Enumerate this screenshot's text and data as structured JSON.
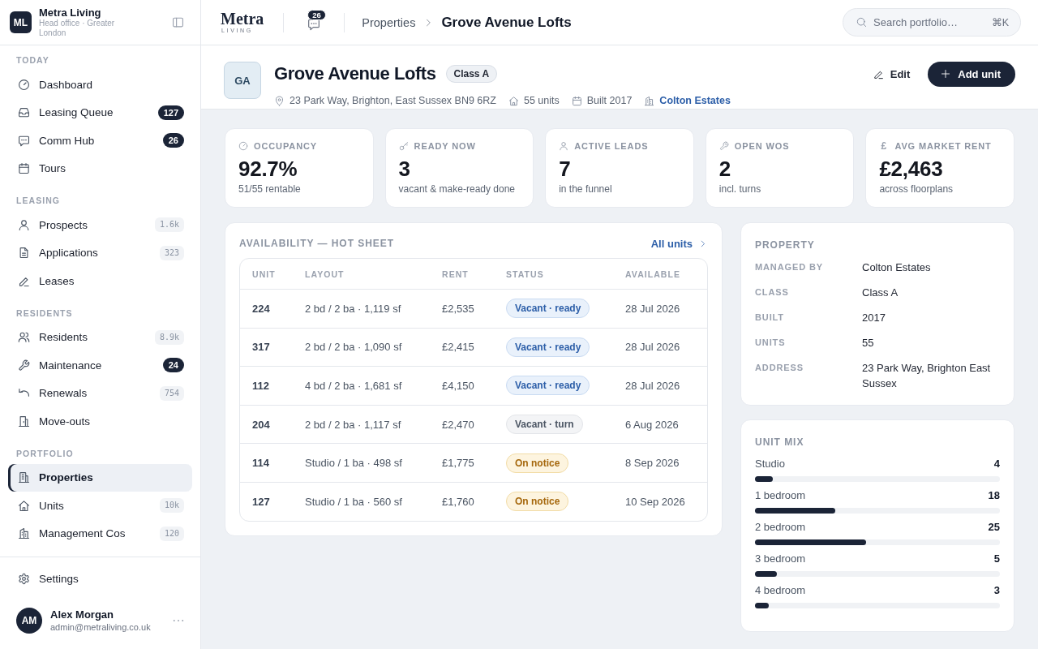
{
  "sidebar": {
    "brand": {
      "initials": "ML",
      "name": "Metra Living",
      "subtitle": "Head office · Greater London"
    },
    "sections": [
      {
        "label": "TODAY",
        "items": [
          {
            "label": "Dashboard",
            "selected": false
          },
          {
            "label": "Leasing Queue",
            "selected": false,
            "badge": {
              "text": "127",
              "kind": "solid"
            }
          },
          {
            "label": "Comm Hub",
            "selected": false,
            "badge": {
              "text": "26",
              "kind": "solid"
            }
          },
          {
            "label": "Tours",
            "selected": false
          }
        ]
      },
      {
        "label": "LEASING",
        "items": [
          {
            "label": "Prospects",
            "selected": false,
            "badge": {
              "text": "1.6k",
              "kind": "subtle"
            }
          },
          {
            "label": "Applications",
            "selected": false,
            "badge": {
              "text": "323",
              "kind": "subtle"
            }
          },
          {
            "label": "Leases",
            "selected": false
          }
        ]
      },
      {
        "label": "RESIDENTS",
        "items": [
          {
            "label": "Residents",
            "selected": false,
            "badge": {
              "text": "8.9k",
              "kind": "subtle"
            }
          },
          {
            "label": "Maintenance",
            "selected": false,
            "badge": {
              "text": "24",
              "kind": "solid"
            }
          },
          {
            "label": "Renewals",
            "selected": false,
            "badge": {
              "text": "754",
              "kind": "subtle"
            }
          },
          {
            "label": "Move-outs",
            "selected": false
          }
        ]
      },
      {
        "label": "PORTFOLIO",
        "items": [
          {
            "label": "Properties",
            "selected": true
          },
          {
            "label": "Units",
            "selected": false,
            "badge": {
              "text": "10k",
              "kind": "subtle"
            }
          },
          {
            "label": "Management Cos",
            "selected": false,
            "badge": {
              "text": "120",
              "kind": "subtle"
            }
          }
        ]
      }
    ],
    "footer_items": [
      {
        "label": "Settings",
        "selected": false
      }
    ],
    "user": {
      "initials": "AM",
      "name": "Alex Morgan",
      "email": "admin@metraliving.co.uk"
    }
  },
  "topbar": {
    "logo": {
      "word": "Metra",
      "tagline": "LIVING"
    },
    "messages_badge": "26",
    "breadcrumb": [
      {
        "label": "Properties",
        "current": false
      },
      {
        "label": "Grove Avenue Lofts",
        "current": true
      }
    ],
    "search": {
      "placeholder": "Search portfolio…",
      "shortcut": "⌘K"
    }
  },
  "property": {
    "initials": "GA",
    "name": "Grove Avenue Lofts",
    "class_badge": "Class A",
    "meta": [
      {
        "text": "23 Park Way, Brighton, East Sussex BN9 6RZ",
        "link": false
      },
      {
        "text": "55 units",
        "link": false
      },
      {
        "text": "Built 2017",
        "link": false
      },
      {
        "text": "Colton Estates",
        "link": true
      }
    ],
    "actions": [
      {
        "label": "Edit",
        "kind": "ghost"
      },
      {
        "label": "Add unit",
        "kind": "primary"
      }
    ]
  },
  "kpis": [
    {
      "label": "OCCUPANCY",
      "value": "92.7%",
      "note": "51/55 rentable"
    },
    {
      "label": "READY NOW",
      "value": "3",
      "note": "vacant & make-ready done"
    },
    {
      "label": "ACTIVE LEADS",
      "value": "7",
      "note": "in the funnel"
    },
    {
      "label": "OPEN WOS",
      "value": "2",
      "note": "incl. turns"
    },
    {
      "label": "AVG MARKET RENT",
      "value": "£2,463",
      "note": "across floorplans",
      "symbol": "£"
    }
  ],
  "availability": {
    "title": "AVAILABILITY — HOT SHEET",
    "link": "All units",
    "columns": [
      "UNIT",
      "LAYOUT",
      "RENT",
      "STATUS",
      "AVAILABLE"
    ],
    "rows": [
      {
        "unit": "224",
        "layout": "2 bd / 2 ba · 1,119 sf",
        "rent": "£2,535",
        "status": {
          "text": "Vacant · ready",
          "kind": "ready"
        },
        "available": "28 Jul 2026"
      },
      {
        "unit": "317",
        "layout": "2 bd / 2 ba · 1,090 sf",
        "rent": "£2,415",
        "status": {
          "text": "Vacant · ready",
          "kind": "ready"
        },
        "available": "28 Jul 2026"
      },
      {
        "unit": "112",
        "layout": "4 bd / 2 ba · 1,681 sf",
        "rent": "£4,150",
        "status": {
          "text": "Vacant · ready",
          "kind": "ready"
        },
        "available": "28 Jul 2026"
      },
      {
        "unit": "204",
        "layout": "2 bd / 2 ba · 1,117 sf",
        "rent": "£2,470",
        "status": {
          "text": "Vacant · turn",
          "kind": "turn"
        },
        "available": "6 Aug 2026"
      },
      {
        "unit": "114",
        "layout": "Studio / 1 ba · 498 sf",
        "rent": "£1,775",
        "status": {
          "text": "On notice",
          "kind": "notice"
        },
        "available": "8 Sep 2026"
      },
      {
        "unit": "127",
        "layout": "Studio / 1 ba · 560 sf",
        "rent": "£1,760",
        "status": {
          "text": "On notice",
          "kind": "notice"
        },
        "available": "10 Sep 2026"
      }
    ]
  },
  "property_details": {
    "title": "PROPERTY",
    "fields": [
      {
        "label": "MANAGED BY",
        "value": "Colton Estates"
      },
      {
        "label": "CLASS",
        "value": "Class A"
      },
      {
        "label": "BUILT",
        "value": "2017"
      },
      {
        "label": "UNITS",
        "value": "55"
      },
      {
        "label": "ADDRESS",
        "value": "23 Park Way, Brighton East Sussex"
      }
    ]
  },
  "unit_mix": {
    "title": "UNIT MIX",
    "items": [
      {
        "label": "Studio",
        "count": "4",
        "level": 0.073
      },
      {
        "label": "1 bedroom",
        "count": "18",
        "level": 0.327
      },
      {
        "label": "2 bedroom",
        "count": "25",
        "level": 0.455
      },
      {
        "label": "3 bedroom",
        "count": "5",
        "level": 0.091
      },
      {
        "label": "4 bedroom",
        "count": "3",
        "level": 0.055
      }
    ]
  }
}
